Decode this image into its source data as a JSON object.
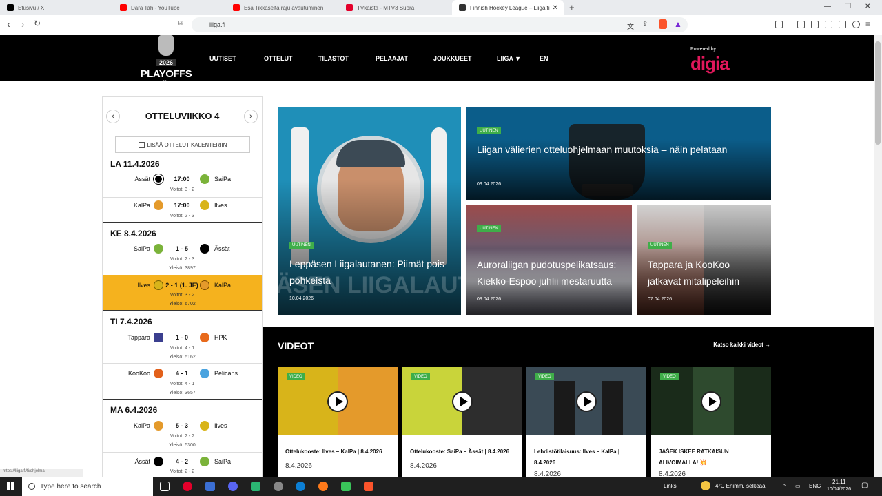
{
  "browser": {
    "tabs": [
      {
        "label": "Etusivu / X",
        "color": "#000000"
      },
      {
        "label": "Dara Tah - YouTube",
        "color": "#ff0000"
      },
      {
        "label": "Esa Tikkaselta raju avautuminen",
        "color": "#ff0000"
      },
      {
        "label": "TVkaista - MTV3 Suora",
        "color": "#e4002b"
      },
      {
        "label": "Finnish Hockey League – Liiga.fi",
        "color": "#333333"
      }
    ],
    "url": "liiga.fi",
    "new_tab": "+",
    "status_url": "https://liiga.fi/fi/ohjelma"
  },
  "site": {
    "logo": {
      "year": "2026",
      "playoffs": "PLAYOFFS",
      "liiga": "Liiga"
    },
    "nav": [
      "UUTISET",
      "OTTELUT",
      "TILASTOT",
      "PELAAJAT",
      "JOUKKUEET",
      "LIIGA ▼",
      "EN"
    ],
    "powered_by": "Powered by",
    "sponsor": "digia",
    "accent": "#f5b21e",
    "badge_color": "#3fae49"
  },
  "schedule": {
    "title": "OTTELUVIIKKO 4",
    "prev": "‹",
    "next": "›",
    "calendar_button": "LISÄÄ OTTELUT KALENTERIIN",
    "days": [
      {
        "label": "LA 11.4.2026"
      },
      {
        "label": "KE 8.4.2026"
      },
      {
        "label": "TI 7.4.2026"
      },
      {
        "label": "MA 6.4.2026"
      }
    ],
    "games": [
      {
        "home": "Ässät",
        "home_color": "#000000",
        "score": "17:00",
        "away": "SaiPa",
        "away_color": "#7bb33a",
        "line1": "Voitot: 3 - 2",
        "line2": ""
      },
      {
        "home": "KalPa",
        "home_color": "#e49a2b",
        "score": "17:00",
        "away": "Ilves",
        "away_color": "#d8b41a",
        "line1": "Voitot: 2 - 3",
        "line2": ""
      },
      {
        "home": "SaiPa",
        "home_color": "#7bb33a",
        "score": "1 - 5",
        "away": "Ässät",
        "away_color": "#000000",
        "line1": "Voitot: 2 - 3",
        "line2": "Yleisö: 3897"
      },
      {
        "home": "Ilves",
        "home_color": "#d8b41a",
        "score": "2 - 1 (1. JE)",
        "away": "KalPa",
        "away_color": "#e49a2b",
        "line1": "Voitot: 3 - 2",
        "line2": "Yleisö: 6702"
      },
      {
        "home": "Tappara",
        "home_color": "#3b3f8f",
        "score": "1 - 0",
        "away": "HPK",
        "away_color": "#e86a1c",
        "line1": "Voitot: 4 - 1",
        "line2": "Yleisö: 5162"
      },
      {
        "home": "KooKoo",
        "home_color": "#e2601a",
        "score": "4 - 1",
        "away": "Pelicans",
        "away_color": "#4aa3df",
        "line1": "Voitot: 4 - 1",
        "line2": "Yleisö: 3657"
      },
      {
        "home": "KalPa",
        "home_color": "#e49a2b",
        "score": "5 - 3",
        "away": "Ilves",
        "away_color": "#d8b41a",
        "line1": "Voitot: 2 - 2",
        "line2": "Yleisö: 5300"
      },
      {
        "home": "Ässät",
        "home_color": "#000000",
        "score": "4 - 2",
        "away": "SaiPa",
        "away_color": "#7bb33a",
        "line1": "Voitot: 2 - 2",
        "line2": ""
      }
    ]
  },
  "news": [
    {
      "badge": "UUTINEN",
      "title": "Leppäsen Liigalautanen: Piimät pois pohkeista",
      "date": "10.04.2026",
      "bg": "#1f8fb8",
      "overlay": "ÄSEN LIIGALAUTAN"
    },
    {
      "badge": "UUTINEN",
      "title": "Liigan välierien otteluohjelmaan muutoksia – näin pelataan",
      "date": "09.04.2026",
      "bg": "#0b5d8a"
    },
    {
      "badge": "UUTINEN",
      "title": "Auroraliigan pudotuspelikatsaus: Kiekko-Espoo juhlii mestaruutta",
      "date": "09.04.2026",
      "bg": "#6b5a6e"
    },
    {
      "badge": "UUTINEN",
      "title": "Tappara ja KooKoo jatkavat mitalipeleihin",
      "date": "07.04.2026",
      "bg": "#a66a3a"
    }
  ],
  "videos": {
    "title": "VIDEOT",
    "all_link": "Katso kaikki videot →",
    "items": [
      {
        "badge": "VIDEO",
        "title": "Ottelukooste: Ilves – KalPa | 8.4.2026",
        "date": "8.4.2026",
        "bg": "#d8b41a"
      },
      {
        "badge": "VIDEO",
        "title": "Ottelukooste: SaiPa – Ässät | 8.4.2026",
        "date": "8.4.2026",
        "bg": "#2d2d2d"
      },
      {
        "badge": "VIDEO",
        "title": "Lehdistötilaisuus: Ilves – KalPa | 8.4.2026",
        "date": "8.4.2026",
        "bg": "#3a4a55"
      },
      {
        "badge": "VIDEO",
        "title": "JAŠEK ISKEE RATKAISUN ALIVOIMALLA! 💥",
        "date": "8.4.2026",
        "bg": "#1a2b1a"
      }
    ]
  },
  "taskbar": {
    "search_placeholder": "Type here to search",
    "links": "Links",
    "weather": "4°C  Enimm. selkeää",
    "lang": "ENG",
    "time": "21.11",
    "date": "10/04/2026"
  }
}
